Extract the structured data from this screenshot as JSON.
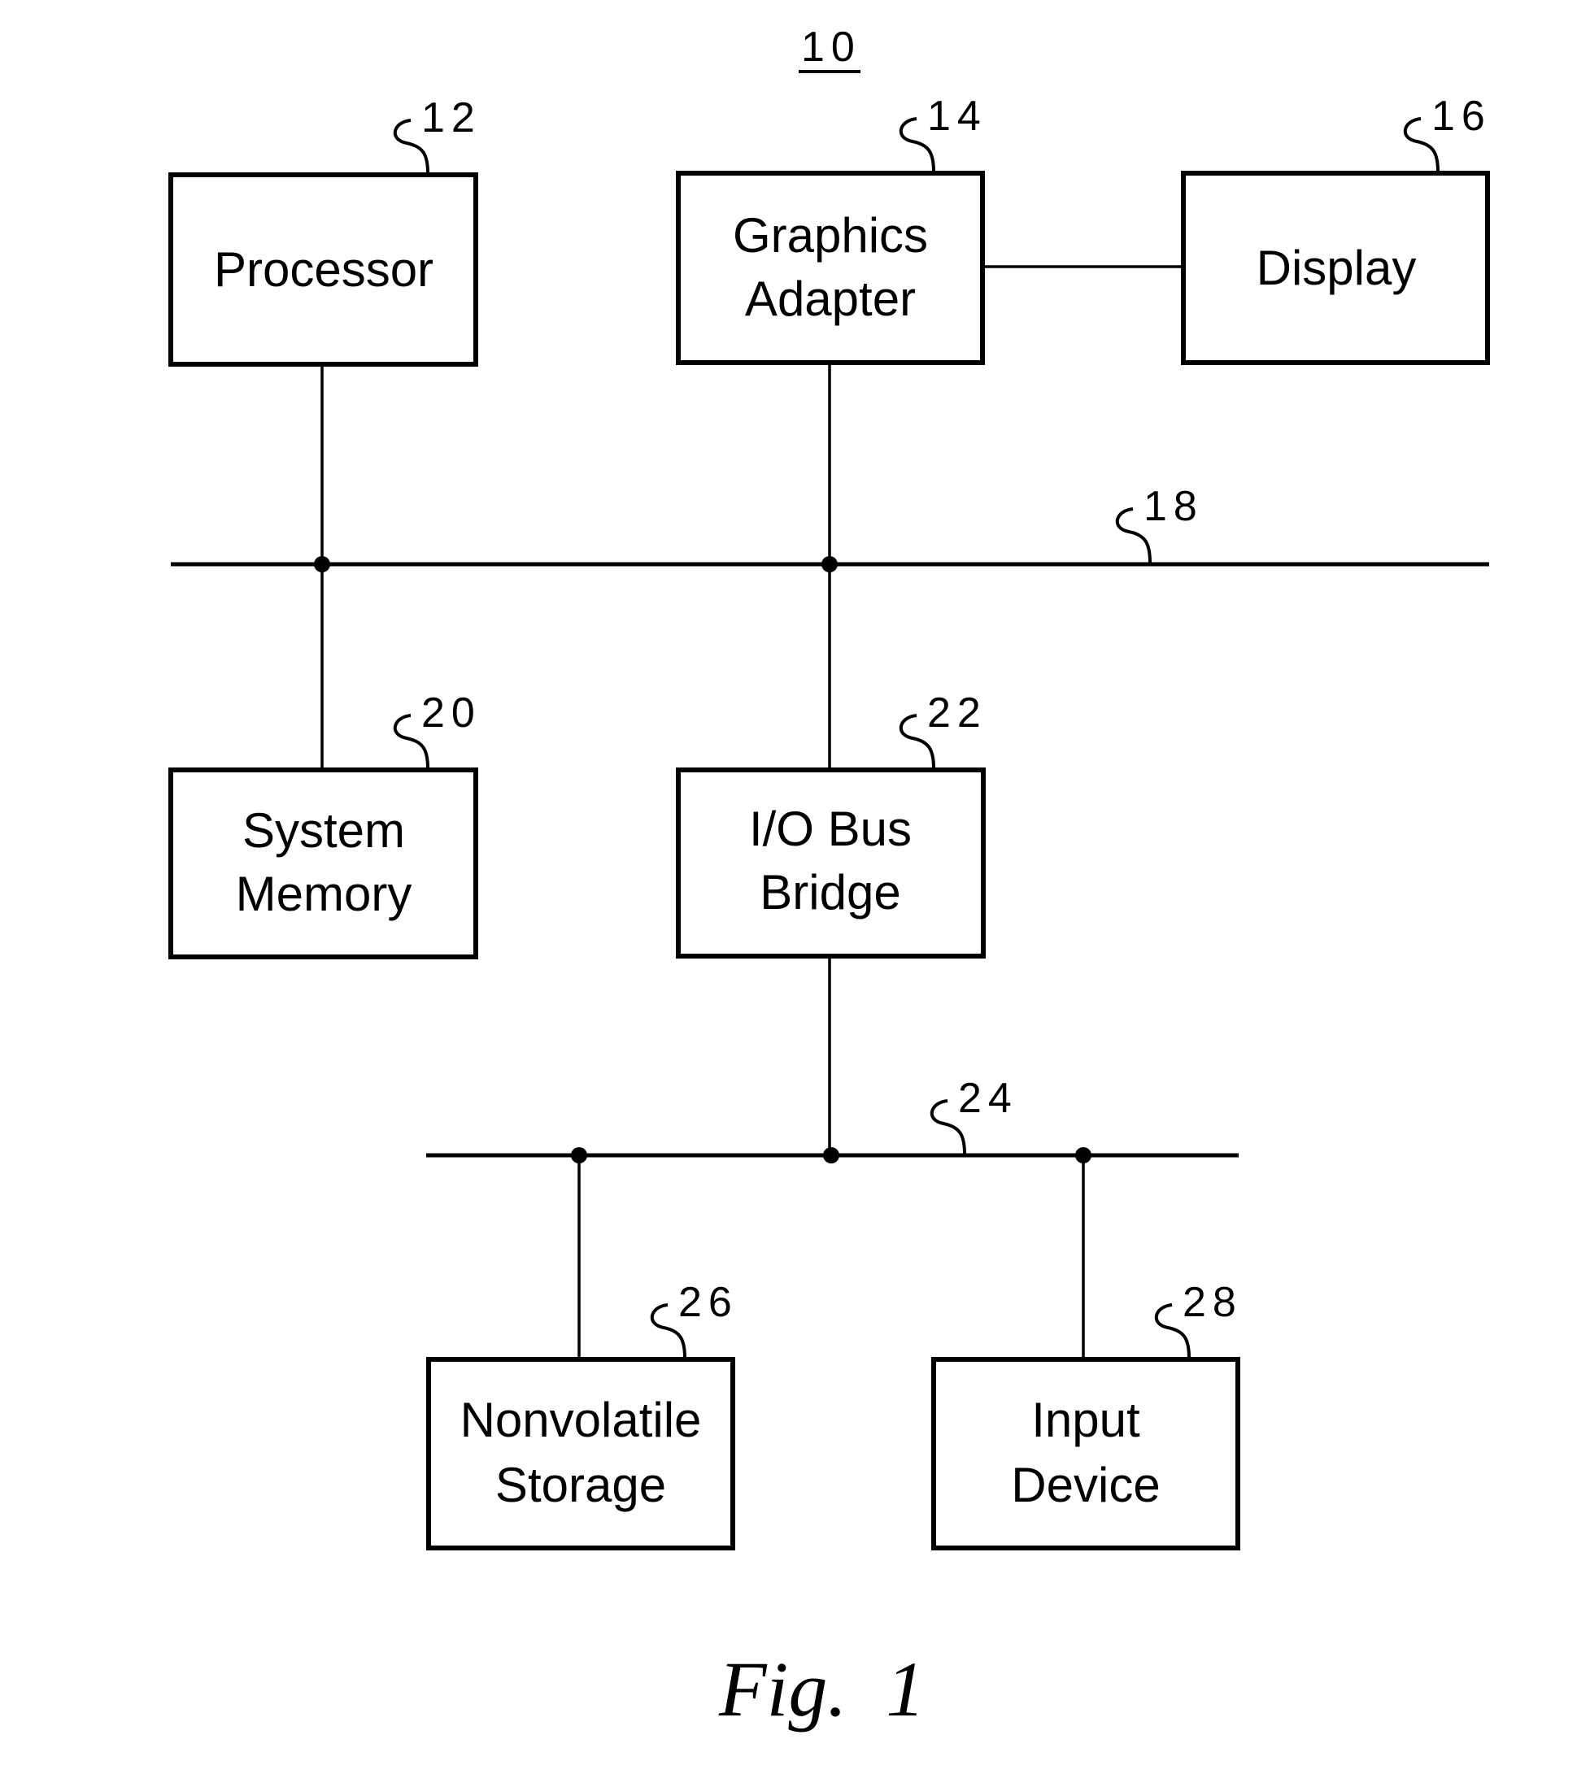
{
  "figure": {
    "ref_number": "10",
    "caption": "Fig.  1"
  },
  "blocks": [
    {
      "id": "processor",
      "ref": "12",
      "lines": [
        "Processor"
      ]
    },
    {
      "id": "graphics-adapter",
      "ref": "14",
      "lines": [
        "Graphics",
        "Adapter"
      ]
    },
    {
      "id": "display",
      "ref": "16",
      "lines": [
        "Display"
      ]
    },
    {
      "id": "system-memory",
      "ref": "20",
      "lines": [
        "System",
        "Memory"
      ]
    },
    {
      "id": "io-bus-bridge",
      "ref": "22",
      "lines": [
        "I/O Bus",
        "Bridge"
      ]
    },
    {
      "id": "nonvolatile-storage",
      "ref": "26",
      "lines": [
        "Nonvolatile",
        "Storage"
      ]
    },
    {
      "id": "input-device",
      "ref": "28",
      "lines": [
        "Input",
        "Device"
      ]
    }
  ],
  "buses": [
    {
      "id": "system-bus",
      "ref": "18"
    },
    {
      "id": "io-bus",
      "ref": "24"
    }
  ],
  "connections": [
    [
      "processor",
      "system-bus"
    ],
    [
      "system-memory",
      "system-bus"
    ],
    [
      "graphics-adapter",
      "system-bus"
    ],
    [
      "graphics-adapter",
      "display"
    ],
    [
      "io-bus-bridge",
      "system-bus"
    ],
    [
      "io-bus-bridge",
      "io-bus"
    ],
    [
      "nonvolatile-storage",
      "io-bus"
    ],
    [
      "input-device",
      "io-bus"
    ]
  ]
}
